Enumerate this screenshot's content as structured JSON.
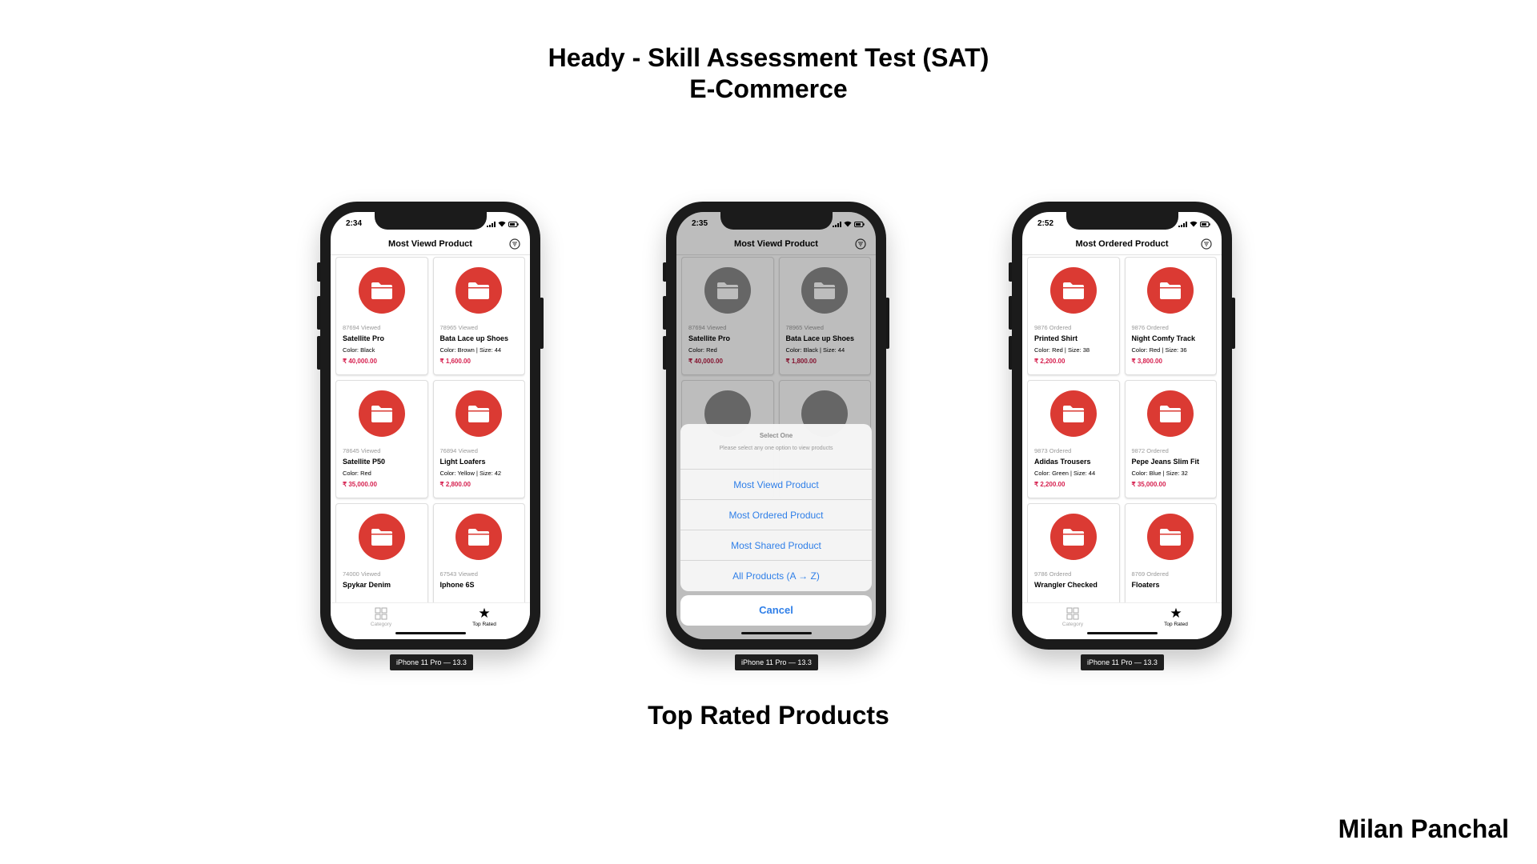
{
  "slide": {
    "title": "Heady - Skill Assessment Test (SAT)",
    "subtitle": "E-Commerce",
    "caption": "Top Rated Products",
    "author": "Milan Panchal"
  },
  "colors": {
    "accent": "#db3a33",
    "price": "#d6204f",
    "link": "#2f7fe8"
  },
  "phones": [
    {
      "time": "2:34",
      "nav_title": "Most Viewd Product",
      "cards": [
        {
          "count": "87694 Viewed",
          "name": "Satellite Pro",
          "meta": "Color: Black",
          "price": "₹ 40,000.00"
        },
        {
          "count": "78965 Viewed",
          "name": "Bata Lace up Shoes",
          "meta": "Color: Brown | Size: 44",
          "price": "₹ 1,600.00"
        },
        {
          "count": "78645 Viewed",
          "name": "Satellite P50",
          "meta": "Color: Red",
          "price": "₹ 35,000.00"
        },
        {
          "count": "76894 Viewed",
          "name": "Light Loafers",
          "meta": "Color: Yellow | Size: 42",
          "price": "₹ 2,800.00"
        },
        {
          "count": "74000 Viewed",
          "name": "Spykar Denim"
        },
        {
          "count": "67543 Viewed",
          "name": "Iphone 6S"
        }
      ],
      "tabs": [
        {
          "label": "Category",
          "icon": "grid-icon"
        },
        {
          "label": "Top Rated",
          "icon": "star-icon"
        }
      ],
      "device_label": "iPhone 11 Pro — 13.3"
    },
    {
      "time": "2:35",
      "nav_title": "Most Viewd Product",
      "cards": [
        {
          "count": "87694 Viewed",
          "name": "Satellite Pro",
          "meta": "Color: Red",
          "price": "₹ 40,000.00"
        },
        {
          "count": "78965 Viewed",
          "name": "Bata Lace up Shoes",
          "meta": "Color: Black | Size: 44",
          "price": "₹ 1,800.00"
        }
      ],
      "sheet": {
        "title": "Select One",
        "message": "Please select any one option to view products",
        "options": [
          "Most Viewd Product",
          "Most Ordered Product",
          "Most Shared Product",
          "All Products (A → Z)"
        ],
        "cancel": "Cancel"
      },
      "device_label": "iPhone 11 Pro — 13.3"
    },
    {
      "time": "2:52",
      "nav_title": "Most Ordered Product",
      "cards": [
        {
          "count": "9876 Ordered",
          "name": "Printed Shirt",
          "meta": "Color: Red | Size: 38",
          "price": "₹ 2,200.00"
        },
        {
          "count": "9876 Ordered",
          "name": "Night Comfy Track",
          "meta": "Color: Red | Size: 36",
          "price": "₹ 3,800.00"
        },
        {
          "count": "9873 Ordered",
          "name": "Adidas Trousers",
          "meta": "Color: Green | Size: 44",
          "price": "₹ 2,200.00"
        },
        {
          "count": "9872 Ordered",
          "name": "Pepe Jeans Slim Fit",
          "meta": "Color: Blue | Size: 32",
          "price": "₹ 35,000.00"
        },
        {
          "count": "9786 Ordered",
          "name": "Wrangler Checked"
        },
        {
          "count": "8769 Ordered",
          "name": "Floaters"
        }
      ],
      "tabs": [
        {
          "label": "Category",
          "icon": "grid-icon"
        },
        {
          "label": "Top Rated",
          "icon": "star-icon"
        }
      ],
      "device_label": "iPhone 11 Pro — 13.3"
    }
  ]
}
